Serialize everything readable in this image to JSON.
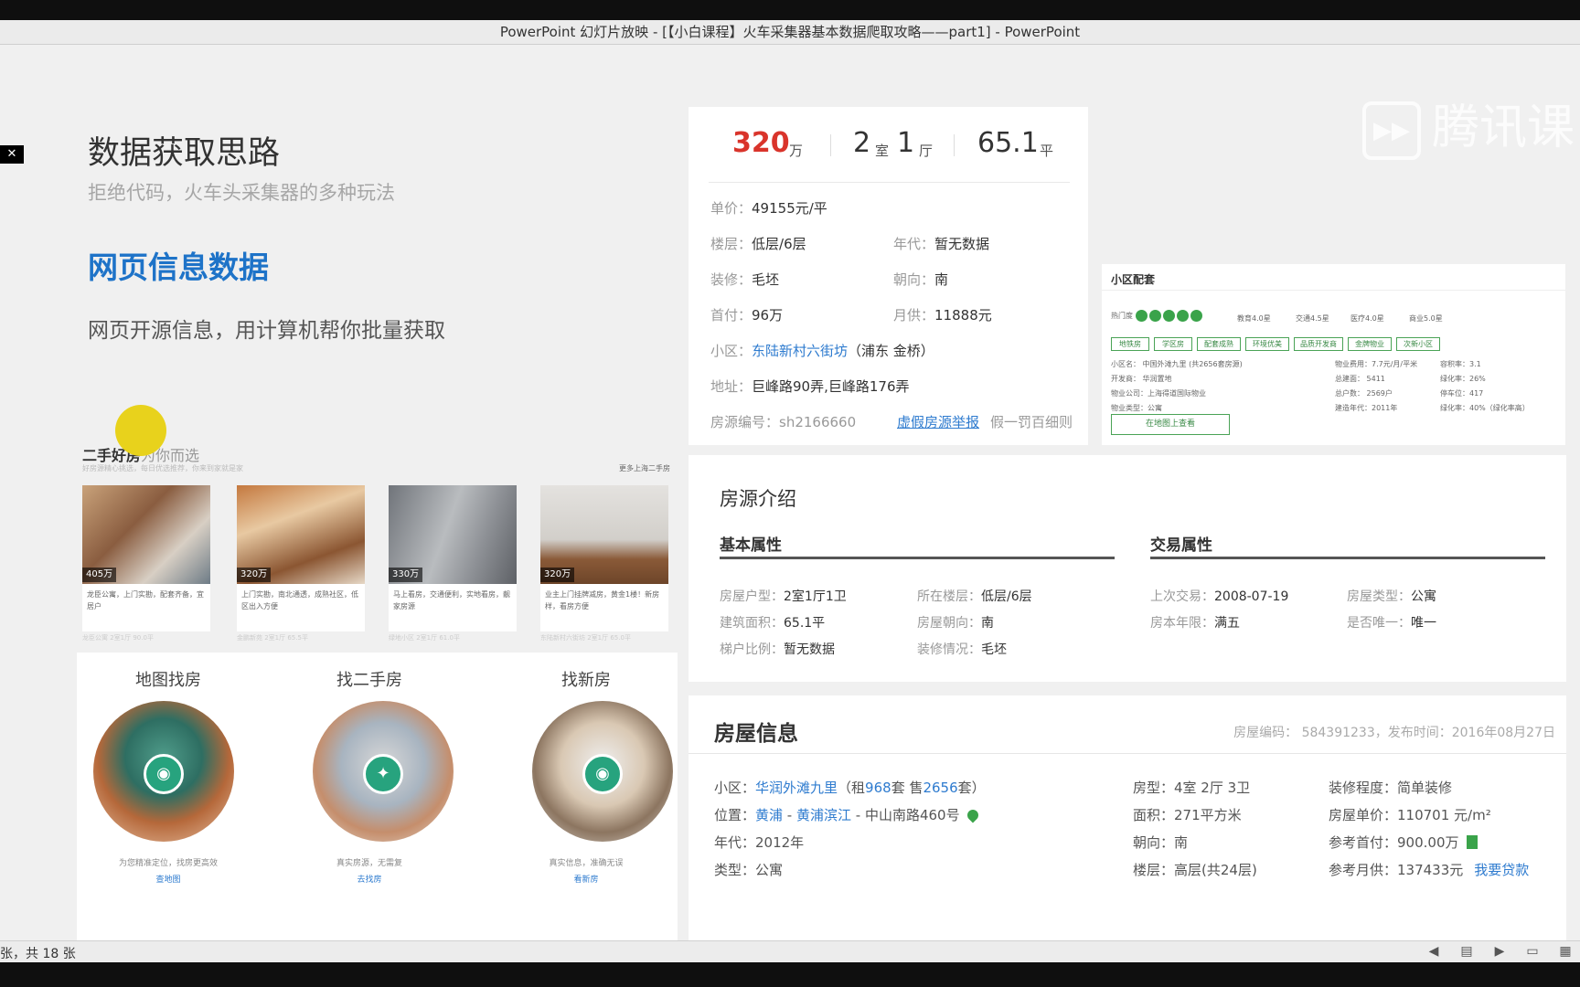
{
  "window": {
    "title": "PowerPoint 幻灯片放映 - [【小白课程】火车采集器基本数据爬取攻略——part1] - PowerPoint"
  },
  "status": {
    "slide_counter": "张，共 18 张"
  },
  "logo": {
    "text": "腾讯课",
    "mark": "▶▶"
  },
  "slide": {
    "title": "数据获取思路",
    "subtitle": "拒绝代码，火车头采集器的多种玩法",
    "heading": "网页信息数据",
    "body": "网页开源信息，用计算机帮你批量获取"
  },
  "price_card": {
    "price": "320",
    "price_unit": "万",
    "rooms": "2",
    "rooms_unit": "室",
    "halls": "1",
    "halls_unit": "厅",
    "area": "65.1",
    "area_unit": "平",
    "unit_price_label": "单价：",
    "unit_price": "49155元/平",
    "floor_label": "楼层：",
    "floor": "低层/6层",
    "year_label": "年代：",
    "year": "暂无数据",
    "decor_label": "装修：",
    "decor": "毛坯",
    "orient_label": "朝向：",
    "orient": "南",
    "down_label": "首付：",
    "down": "96万",
    "monthly_label": "月供：",
    "monthly": "11888元",
    "community_label": "小区：",
    "community": "东陆新村六街坊",
    "community_area": "（浦东 金桥）",
    "address_label": "地址：",
    "address": "巨峰路90弄,巨峰路176弄",
    "listing_id": "房源编号：sh2166660",
    "report_link": "虚假房源举报",
    "report_note": "假一罚百细则"
  },
  "community_panel": {
    "title": "小区配套",
    "hot_label": "热门度",
    "scores": [
      "教育4.0星",
      "交通4.5星",
      "医疗4.0星",
      "商业5.0星"
    ],
    "tags": [
      "地铁房",
      "学区房",
      "配套成熟",
      "环境优美",
      "品质开发商",
      "金牌物业",
      "次新小区"
    ],
    "col1": [
      "小区名：  中国外滩九里 (共2656套房源)",
      "开发商：  华润置地",
      "物业公司：上海得道国际物业",
      "物业类型：公寓"
    ],
    "col2": [
      "物业费用：7.7元/月/平米",
      "总建面：  5411",
      "总户数：  2569户",
      "建造年代：2011年"
    ],
    "col3": [
      "容积率：3.1",
      "绿化率：26%",
      "停车位：417",
      "绿化率：40%（绿化率高）"
    ],
    "map_button": "在地图上查看"
  },
  "intro": {
    "title": "房源介绍",
    "basic_title": "基本属性",
    "trade_title": "交易属性",
    "basic": [
      {
        "label": "房屋户型：",
        "value": "2室1厅1卫"
      },
      {
        "label": "所在楼层：",
        "value": "低层/6层"
      },
      {
        "label": "建筑面积：",
        "value": "65.1平"
      },
      {
        "label": "房屋朝向：",
        "value": "南"
      },
      {
        "label": "梯户比例：",
        "value": "暂无数据"
      },
      {
        "label": "装修情况：",
        "value": "毛坯"
      }
    ],
    "trade": [
      {
        "label": "上次交易：",
        "value": "2008-07-19"
      },
      {
        "label": "房屋类型：",
        "value": "公寓"
      },
      {
        "label": "房本年限：",
        "value": "满五"
      },
      {
        "label": "是否唯一：",
        "value": "唯一"
      }
    ]
  },
  "house": {
    "title": "房屋信息",
    "meta": "房屋编码：  584391233，发布时间：2016年08月27日",
    "community_label": "小区：",
    "community": "华润外滩九里",
    "rent_pre": "（租",
    "rent_count": "968",
    "rent_mid": "套 售",
    "sale_count": "2656",
    "sale_post": "套）",
    "location_label": "位置：",
    "loc1": "黄浦",
    "loc2": "黄浦滨江",
    "loc3": "中山南路460号",
    "year": "年代：2012年",
    "type": "类型：公寓",
    "layout": "房型：4室 2厅 3卫",
    "area": "面积：271平方米",
    "orient": "朝向：南",
    "floor": "楼层：高层(共24层)",
    "decor": "装修程度：简单装修",
    "unit_price": "房屋单价：110701 元/m²",
    "down": "参考首付：900.00万",
    "monthly": "参考月供：137433元",
    "loan_link": "我要贷款"
  },
  "listings": {
    "title": "二手好房",
    "title_tail": "为你而选",
    "note": "好房源精心挑选，每日优选推荐，你来到家就是家",
    "more": "更多上海二手房",
    "cards": [
      {
        "price": "405万",
        "text": "龙臣公寓，上门实勘，配套齐备，宜居户",
        "meta": "龙臣公寓  2室1厅  90.0平"
      },
      {
        "price": "320万",
        "text": "上门实勘，南北通透，成熟社区，低区出入方便",
        "meta": "金鹏新苑  2室1厅  65.5平"
      },
      {
        "price": "330万",
        "text": "马上看房，交通便利，实地看房，靓家房源",
        "meta": "绿地小区  2室1厅  61.0平"
      },
      {
        "price": "320万",
        "text": "业主上门挂牌减房，黄金1楼！新房样，看房方便",
        "meta": "东陆新村六街坊  2室1厅  65.0平"
      }
    ]
  },
  "features": [
    {
      "title": "地图找房",
      "caption": "为您精准定位，找房更高效",
      "link": "查地图",
      "icon": "◉"
    },
    {
      "title": "找二手房",
      "caption": "真实房源，无需复",
      "link": "去找房",
      "icon": "✦"
    },
    {
      "title": "找新房",
      "caption": "真实信息，准确无误",
      "link": "看新房",
      "icon": "◉"
    }
  ],
  "colors": {
    "accent_blue": "#1e73c8",
    "price_red": "#d9342b",
    "green": "#3aa34a"
  }
}
